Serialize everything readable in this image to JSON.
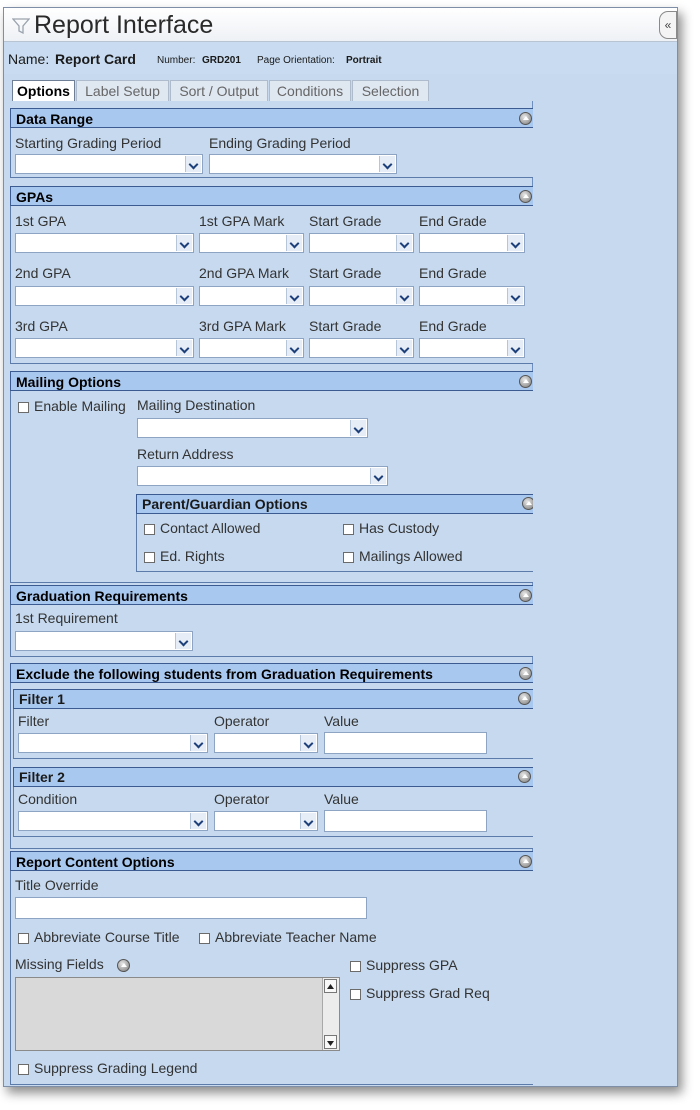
{
  "window": {
    "title": "Report Interface",
    "collapse_label": "«",
    "name_label": "Name:",
    "name_value": "Report Card",
    "number_label": "Number:",
    "number_value": "GRD201",
    "orientation_label": "Page Orientation:",
    "orientation_value": "Portrait"
  },
  "tabs": [
    "Options",
    "Label Setup",
    "Sort / Output",
    "Conditions",
    "Selection"
  ],
  "data_range": {
    "heading": "Data Range",
    "start_label": "Starting Grading Period",
    "end_label": "Ending Grading Period"
  },
  "gpas": {
    "heading": "GPAs",
    "rows": [
      {
        "gpa": "1st GPA",
        "mark": "1st GPA Mark",
        "start": "Start Grade",
        "end": "End Grade"
      },
      {
        "gpa": "2nd GPA",
        "mark": "2nd GPA Mark",
        "start": "Start Grade",
        "end": "End Grade"
      },
      {
        "gpa": "3rd GPA",
        "mark": "3rd GPA Mark",
        "start": "Start Grade",
        "end": "End Grade"
      }
    ]
  },
  "mailing": {
    "heading": "Mailing Options",
    "enable_label": "Enable Mailing",
    "destination_label": "Mailing Destination",
    "return_label": "Return Address",
    "guardian": {
      "heading": "Parent/Guardian Options",
      "contact": "Contact Allowed",
      "custody": "Has Custody",
      "ed_rights": "Ed. Rights",
      "mailings": "Mailings Allowed"
    }
  },
  "graduation": {
    "heading": "Graduation Requirements",
    "req_label": "1st Requirement"
  },
  "exclude": {
    "heading": "Exclude the following students from Graduation Requirements",
    "filter1": {
      "heading": "Filter 1",
      "filter_label": "Filter",
      "operator_label": "Operator",
      "value_label": "Value"
    },
    "filter2": {
      "heading": "Filter 2",
      "condition_label": "Condition",
      "operator_label": "Operator",
      "value_label": "Value"
    }
  },
  "content_opts": {
    "heading": "Report Content Options",
    "title_override_label": "Title Override",
    "abbr_course": "Abbreviate Course Title",
    "abbr_teacher": "Abbreviate Teacher Name",
    "missing_fields": "Missing Fields",
    "suppress_gpa": "Suppress GPA",
    "suppress_grad": "Suppress Grad Req",
    "suppress_legend": "Suppress Grading Legend"
  }
}
